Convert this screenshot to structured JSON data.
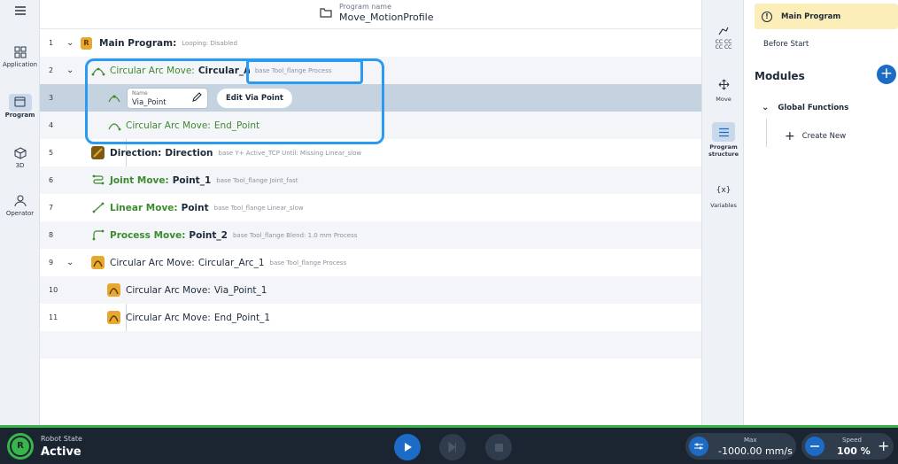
{
  "program": {
    "label": "Program name",
    "name": "Move_MotionProfile"
  },
  "leftnav": [
    {
      "label": "Application"
    },
    {
      "label": "Program"
    },
    {
      "label": "3D"
    },
    {
      "label": "Operator"
    }
  ],
  "rows": [
    {
      "num": "1",
      "prefix": "Main Program:",
      "rest": "",
      "meta": "Looping: Disabled"
    },
    {
      "num": "2",
      "prefix": "Circular Arc Move:",
      "rest": "Circular_Arc",
      "meta": "base  Tool_flange  Process"
    },
    {
      "num": "3"
    },
    {
      "num": "4",
      "prefix": "Circular Arc Move:",
      "rest": "End_Point",
      "meta": ""
    },
    {
      "num": "5",
      "prefix": "Direction:",
      "rest": "Direction",
      "meta": "base  Y+  Active_TCP  Until: Missing  Linear_slow"
    },
    {
      "num": "6",
      "prefix": "Joint Move:",
      "rest": "Point_1",
      "meta": "base  Tool_flange  Joint_fast"
    },
    {
      "num": "7",
      "prefix": "Linear Move:",
      "rest": "Point",
      "meta": "base  Tool_flange  Linear_slow"
    },
    {
      "num": "8",
      "prefix": "Process Move:",
      "rest": "Point_2",
      "meta": "base  Tool_flange  Blend: 1.0 mm  Process"
    },
    {
      "num": "9",
      "prefix": "Circular Arc Move:",
      "rest": "Circular_Arc_1",
      "meta": "base  Tool_flange  Process"
    },
    {
      "num": "10",
      "prefix": "Circular Arc Move:",
      "rest": "Via_Point_1",
      "meta": ""
    },
    {
      "num": "11",
      "prefix": "Circular Arc Move:",
      "rest": "End_Point_1",
      "meta": ""
    }
  ],
  "via": {
    "name_label": "Name",
    "name_value": "Via_Point",
    "edit_button": "Edit Via Point"
  },
  "tools": [
    {
      "label": ""
    },
    {
      "label": ""
    },
    {
      "label": "Move"
    },
    {
      "label": "Program structure"
    },
    {
      "label": "Variables"
    }
  ],
  "panel": {
    "main_program": "Main Program",
    "before_start": "Before Start",
    "modules": "Modules",
    "global_functions": "Global Functions",
    "create_new": "Create New"
  },
  "bottom": {
    "robot_state_label": "Robot State",
    "robot_state": "Active",
    "max_label": "Max",
    "max_value": "-1000.00 mm/s",
    "speed_label": "Speed",
    "speed_value": "100 %"
  },
  "colors": {
    "accent": "#1b6bc7",
    "highlight": "#2a9bf0",
    "status": "#3ab54a",
    "move_green": "#3c8b2f"
  }
}
